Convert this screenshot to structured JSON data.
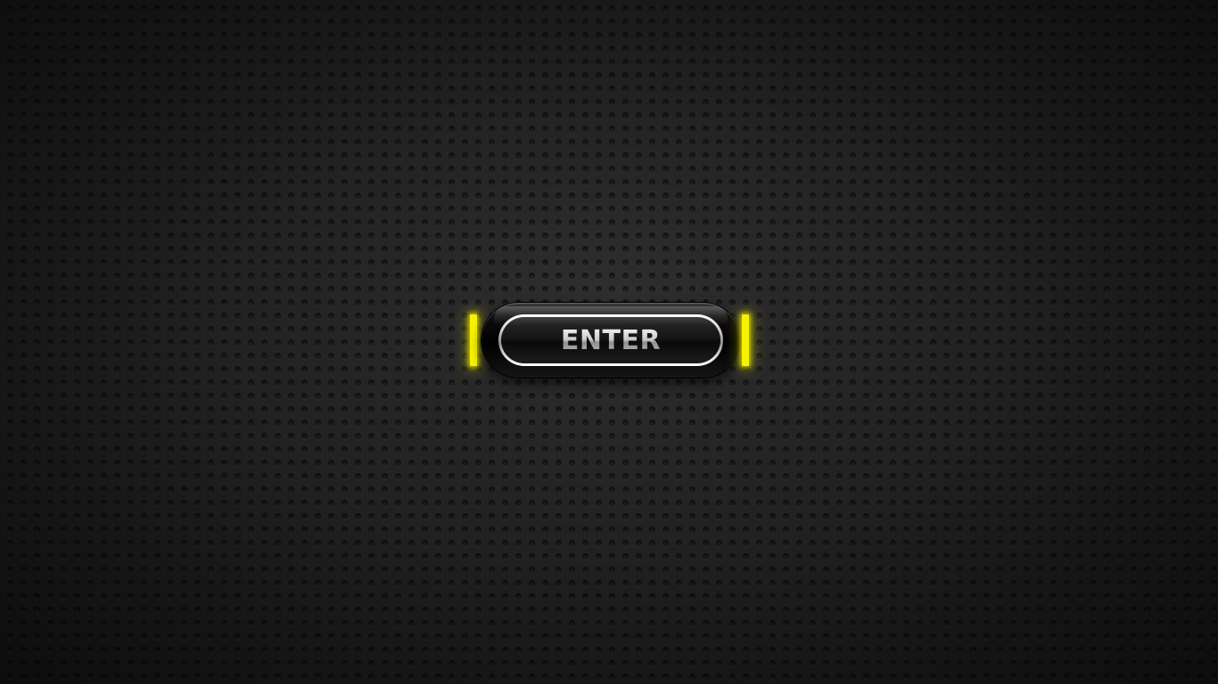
{
  "enter_button": {
    "label": "ENTER"
  },
  "colors": {
    "accent_glow": "#f6f200",
    "background": "#1e1e1e",
    "button_body": "#000000",
    "ring": "#d0d0d0"
  }
}
